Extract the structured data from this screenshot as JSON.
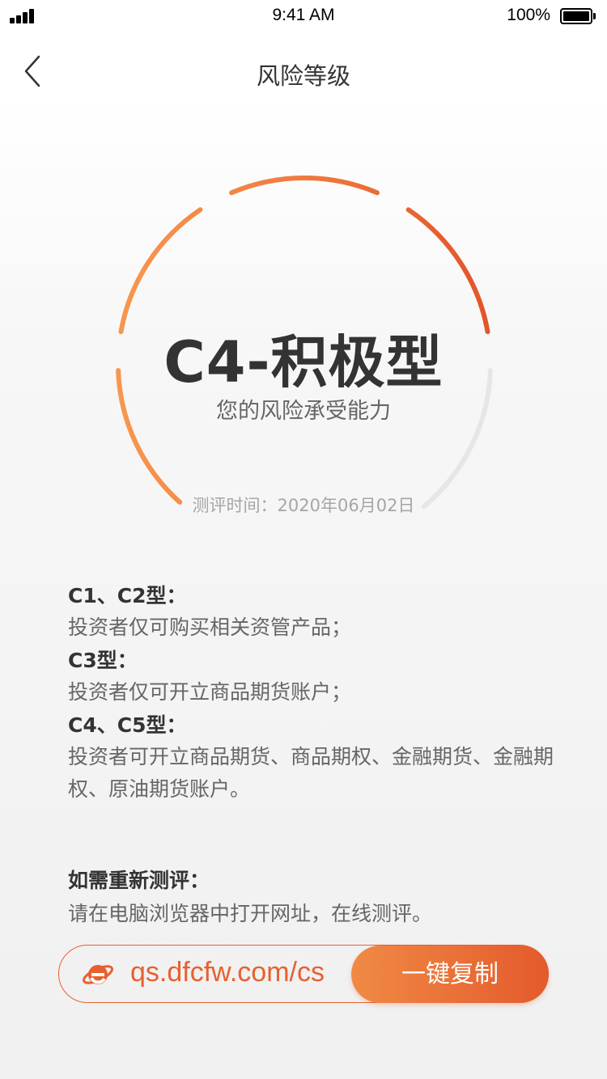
{
  "status_bar": {
    "time": "9:41 AM",
    "battery": "100%"
  },
  "nav": {
    "title": "风险等级"
  },
  "result": {
    "level": "C4-积极型",
    "subtitle": "您的风险承受能力",
    "eval_date": "测评时间：2020年06月02日"
  },
  "descriptions": [
    {
      "heading": "C1、C2型：",
      "body": "投资者仅可购买相关资管产品；"
    },
    {
      "heading": "C3型：",
      "body": "投资者仅可开立商品期货账户；"
    },
    {
      "heading": "C4、C5型：",
      "body": "投资者可开立商品期货、商品期权、金融期货、金融期权、原油期货账户。"
    }
  ],
  "reeval": {
    "heading": "如需重新测评：",
    "body": "请在电脑浏览器中打开网址，在线测评。"
  },
  "url_box": {
    "url": "qs.dfcfw.com/cs",
    "copy_label": "一键复制"
  },
  "colors": {
    "accent": "#e8602f",
    "accent_light": "#f5934a",
    "track": "#e6e6e6",
    "text_primary": "#333333",
    "text_secondary": "#666666",
    "text_muted": "#a6a6a6"
  },
  "icons": {
    "back": "chevron-left-icon",
    "browser": "ie-browser-icon"
  }
}
